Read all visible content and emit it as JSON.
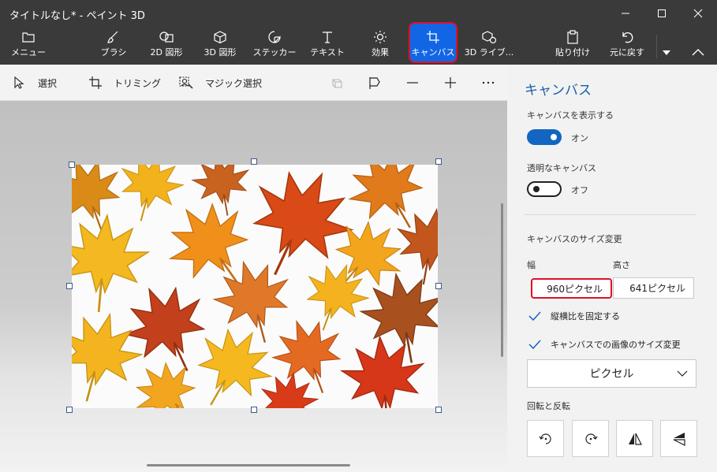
{
  "window": {
    "title": "タイトルなし* - ペイント 3D"
  },
  "ribbon": {
    "menu": "メニュー",
    "brush": "ブラシ",
    "shapes2d": "2D 図形",
    "shapes3d": "3D 図形",
    "stickers": "ステッカー",
    "text": "テキスト",
    "effects": "効果",
    "canvas": "キャンバス",
    "library3d": "3D ライブ...",
    "paste": "貼り付け",
    "undo": "元に戻す"
  },
  "toolbar": {
    "select": "選択",
    "crop": "トリミング",
    "magic_select": "マジック選択"
  },
  "panel": {
    "title": "キャンバス",
    "show_canvas_label": "キャンバスを表示する",
    "show_canvas_state": "オン",
    "transparent_label": "透明なキャンバス",
    "transparent_state": "オフ",
    "resize_heading": "キャンバスのサイズ変更",
    "width_label": "幅",
    "height_label": "高さ",
    "width_value": "960ピクセル",
    "height_value": "641ピクセル",
    "lock_aspect": "縦横比を固定する",
    "resize_image": "キャンバスでの画像のサイズ変更",
    "unit": "ピクセル",
    "rotate_flip": "回転と反転"
  },
  "colors": {
    "accent": "#1266e6",
    "highlight": "#e0102a"
  }
}
